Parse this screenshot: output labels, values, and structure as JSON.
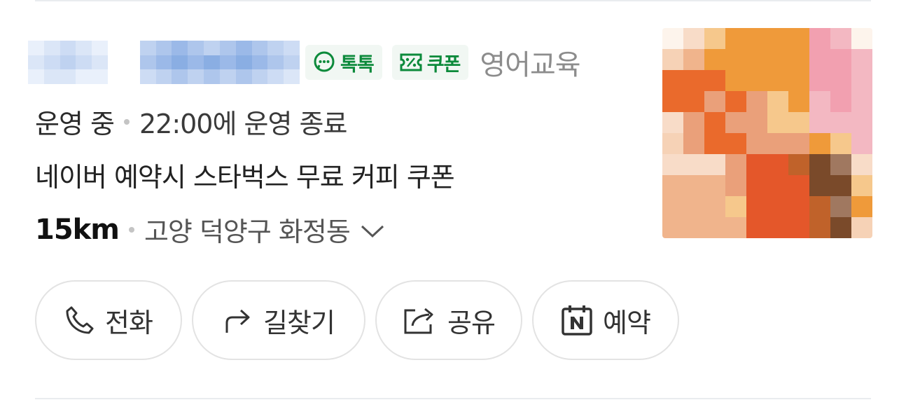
{
  "place": {
    "name_redacted": true,
    "badges": [
      {
        "label": "톡톡",
        "icon": "chat-bubble-icon"
      },
      {
        "label": "쿠폰",
        "icon": "coupon-icon"
      }
    ],
    "category": "영어교육",
    "status": "운영 중",
    "closing": "22:00에 운영 종료",
    "promo": "네이버 예약시 스타벅스 무료 커피 쿠폰",
    "distance": "15km",
    "address": "고양 덕양구 화정동"
  },
  "actions": [
    {
      "label": "전화",
      "icon": "phone-icon"
    },
    {
      "label": "길찾기",
      "icon": "directions-arrow-icon"
    },
    {
      "label": "공유",
      "icon": "share-icon"
    },
    {
      "label": "예약",
      "icon": "naver-booking-icon"
    }
  ],
  "colors": {
    "accent_green": "#0c8a3b",
    "chip_bg": "#f1f7f3",
    "muted_text": "#8c8c8c",
    "border": "#e3e3e3"
  }
}
